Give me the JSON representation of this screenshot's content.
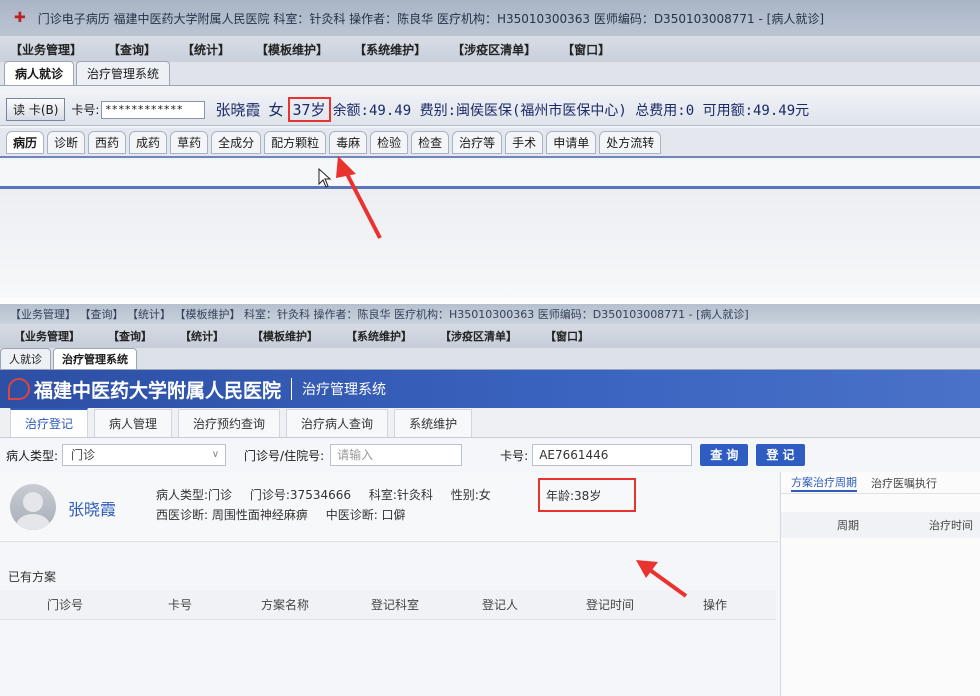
{
  "shot1": {
    "window_title": "门诊电子病历  福建中医药大学附属人民医院  科室：针灸科  操作者：陈良华  医疗机构：H35010300363  医师编码：D350103008771 - [病人就诊]",
    "menu": [
      "【业务管理】",
      "【查询】",
      "【统计】",
      "【模板维护】",
      "【系统维护】",
      "【涉疫区清单】",
      "【窗口】"
    ],
    "tabs": [
      "病人就诊",
      "治疗管理系统"
    ],
    "read_card_label": "读 卡(B)",
    "card_label": "卡号:",
    "card_value": "************",
    "patient_name": "张晓霞",
    "patient_gender": "女",
    "patient_age": "37岁",
    "patient_info": "余额:49.49 费别:闽侯医保(福州市医保中心) 总费用:0 可用额:49.49元",
    "subtabs": [
      "病历",
      "诊断",
      "西药",
      "成药",
      "草药",
      "全成分",
      "配方颗粒",
      "毒麻",
      "检验",
      "检查",
      "治疗等",
      "手术",
      "申请单",
      "处方流转"
    ]
  },
  "shot2": {
    "top_bar": "【业务管理】  【查询】  【统计】  【模板维护】  科室：针灸科  操作者：陈良华  医疗机构：H35010300363  医师编码：D350103008771 - [病人就诊]",
    "menu": [
      "【业务管理】",
      "【查询】",
      "【统计】",
      "【模板维护】",
      "【系统维护】",
      "【涉疫区清单】",
      "【窗口】"
    ],
    "tabs": [
      "人就诊",
      "治疗管理系统"
    ],
    "hospital_name": "福建中医药大学附属人民医院",
    "system_name": "治疗管理系统",
    "nav_tabs": [
      "治疗登记",
      "病人管理",
      "治疗预约查询",
      "治疗病人查询",
      "系统维护"
    ],
    "patient_type_label": "病人类型:",
    "patient_type_value": "门诊",
    "mz_label": "门诊号/住院号:",
    "mz_placeholder": "请输入",
    "card_label": "卡号:",
    "card_value": "AE7661446",
    "query_button": "查 询",
    "register_button": "登 记",
    "patient": {
      "name": "张晓霞",
      "type": "病人类型:门诊",
      "mz_no": "门诊号:37534666",
      "dept": "科室:针灸科",
      "gender": "性别:女",
      "age": "年龄:38岁",
      "west_diag": "西医诊断: 周围性面神经麻痹",
      "tcm_diag": "中医诊断: 口僻"
    },
    "plans_title": "已有方案",
    "table_headers": [
      "门诊号",
      "卡号",
      "方案名称",
      "登记科室",
      "登记人",
      "登记时间",
      "操作"
    ],
    "right_tabs": [
      "方案治疗周期",
      "治疗医嘱执行"
    ],
    "right_headers": [
      "周期",
      "治疗时间"
    ]
  },
  "colors": {
    "accent_blue": "#2e5cc1",
    "highlight_red": "#e8332f"
  }
}
